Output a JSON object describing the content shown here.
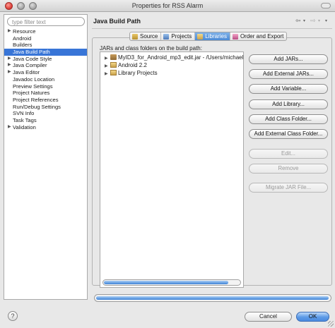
{
  "window": {
    "title": "Properties for RSS Alarm"
  },
  "sidebar": {
    "filter_placeholder": "type filter text",
    "items": [
      {
        "label": "Resource",
        "expandable": true
      },
      {
        "label": "Android",
        "expandable": false
      },
      {
        "label": "Builders",
        "expandable": false
      },
      {
        "label": "Java Build Path",
        "expandable": false,
        "selected": true
      },
      {
        "label": "Java Code Style",
        "expandable": true
      },
      {
        "label": "Java Compiler",
        "expandable": true
      },
      {
        "label": "Java Editor",
        "expandable": true
      },
      {
        "label": "Javadoc Location",
        "expandable": false
      },
      {
        "label": "Preview Settings",
        "expandable": false
      },
      {
        "label": "Project Natures",
        "expandable": false
      },
      {
        "label": "Project References",
        "expandable": false
      },
      {
        "label": "Run/Debug Settings",
        "expandable": false
      },
      {
        "label": "SVN Info",
        "expandable": false
      },
      {
        "label": "Task Tags",
        "expandable": false
      },
      {
        "label": "Validation",
        "expandable": true
      }
    ],
    "selected_color": "#3875d7"
  },
  "page": {
    "title": "Java Build Path",
    "tabs": [
      {
        "label": "Source",
        "icon": "source-folder-icon",
        "active": false
      },
      {
        "label": "Projects",
        "icon": "projects-icon",
        "active": false
      },
      {
        "label": "Libraries",
        "icon": "libraries-icon",
        "active": true
      },
      {
        "label": "Order and Export",
        "icon": "order-export-icon",
        "active": false
      }
    ],
    "section_label": "JARs and class folders on the build path:",
    "libraries": [
      {
        "label": "MyID3_for_Android_mp3_edit.jar - /Users/michael/",
        "icon": "jar-icon"
      },
      {
        "label": "Android 2.2",
        "icon": "library-icon"
      },
      {
        "label": "Library Projects",
        "icon": "library-icon"
      }
    ]
  },
  "buttons": {
    "add_jars": "Add JARs...",
    "add_external_jars": "Add External JARs...",
    "add_variable": "Add Variable...",
    "add_library": "Add Library...",
    "add_class_folder": "Add Class Folder...",
    "add_external_class_folder": "Add External Class Folder...",
    "edit": "Edit...",
    "remove": "Remove",
    "migrate_jar": "Migrate JAR File..."
  },
  "footer": {
    "help_label": "?",
    "cancel_label": "Cancel",
    "ok_label": "OK"
  },
  "colors": {
    "accent": "#3875d7",
    "window_bg": "#e8e8e8"
  }
}
